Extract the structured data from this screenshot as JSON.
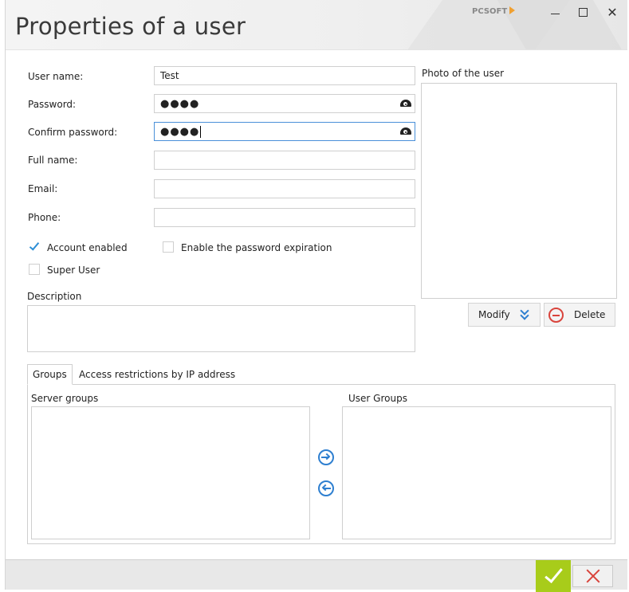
{
  "window": {
    "title": "Properties of a user",
    "brand": "PCSOFT"
  },
  "form": {
    "user_name_label": "User name:",
    "user_name_value": "Test",
    "password_label": "Password:",
    "password_value": "●●●●",
    "confirm_password_label": "Confirm password:",
    "confirm_password_value": "●●●●",
    "full_name_label": "Full name:",
    "full_name_value": "",
    "email_label": "Email:",
    "email_value": "",
    "phone_label": "Phone:",
    "phone_value": "",
    "account_enabled_label": "Account enabled",
    "account_enabled_checked": true,
    "password_expiration_label": "Enable the password expiration",
    "password_expiration_checked": false,
    "super_user_label": "Super User",
    "super_user_checked": false,
    "description_label": "Description",
    "description_value": ""
  },
  "photo": {
    "label": "Photo of the user",
    "modify_label": "Modify",
    "delete_label": "Delete"
  },
  "tabs": [
    {
      "label": "Groups",
      "active": true
    },
    {
      "label": "Access restrictions by IP address",
      "active": false
    }
  ],
  "groups": {
    "server_groups_label": "Server groups",
    "user_groups_label": "User Groups",
    "server_groups": [],
    "user_groups": []
  },
  "colors": {
    "accent": "#2e7fd0",
    "ok": "#a8cc1a",
    "danger": "#d9443c"
  }
}
